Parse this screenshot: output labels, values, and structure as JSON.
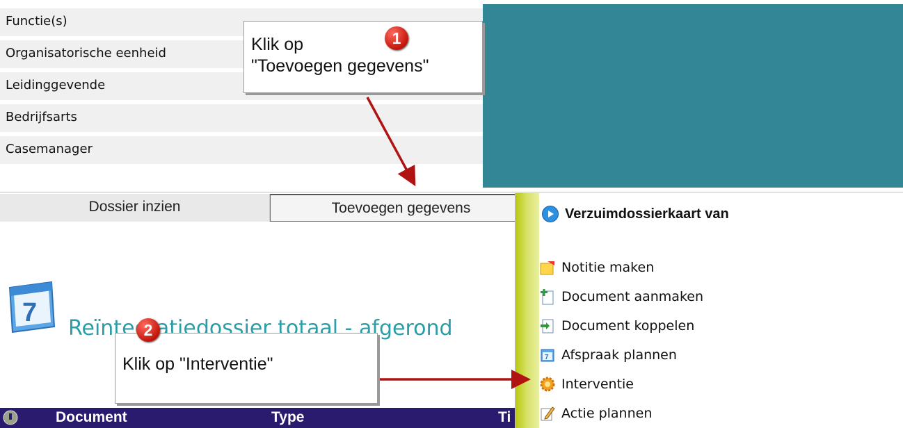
{
  "profile_fields": [
    "Functie(s)",
    "Organisatorische eenheid",
    "Leidinggevende",
    "Bedrijfsarts",
    "Casemanager"
  ],
  "tabs": {
    "dossier": "Dossier inzien",
    "toevoegen": "Toevoegen gegevens"
  },
  "callout1": {
    "number": "1",
    "line1": "Klik op",
    "line2": "\"Toevoegen gegevens\""
  },
  "callout2": {
    "number": "2",
    "text": "Klik op \"Interventie\""
  },
  "section": {
    "heading": "Reïntegratiedossier totaal - afgerond",
    "calendar_day": "7"
  },
  "menu": {
    "title": "Verzuimdossierkaart van",
    "title_icon": "play-circle-icon",
    "items": [
      {
        "label": "Notitie maken",
        "icon": "note-icon"
      },
      {
        "label": "Document aanmaken",
        "icon": "document-add-icon"
      },
      {
        "label": "Document koppelen",
        "icon": "document-link-icon"
      },
      {
        "label": "Afspraak plannen",
        "icon": "calendar-icon"
      },
      {
        "label": "Interventie",
        "icon": "gear-icon"
      },
      {
        "label": "Actie plannen",
        "icon": "pencil-icon"
      }
    ]
  },
  "table_headers": {
    "document": "Document",
    "type": "Type",
    "ti": "Ti"
  },
  "colors": {
    "teal_block": "#338696",
    "heading": "#2a9da6",
    "table_header": "#2a1b6e",
    "arrow": "#b11212"
  }
}
